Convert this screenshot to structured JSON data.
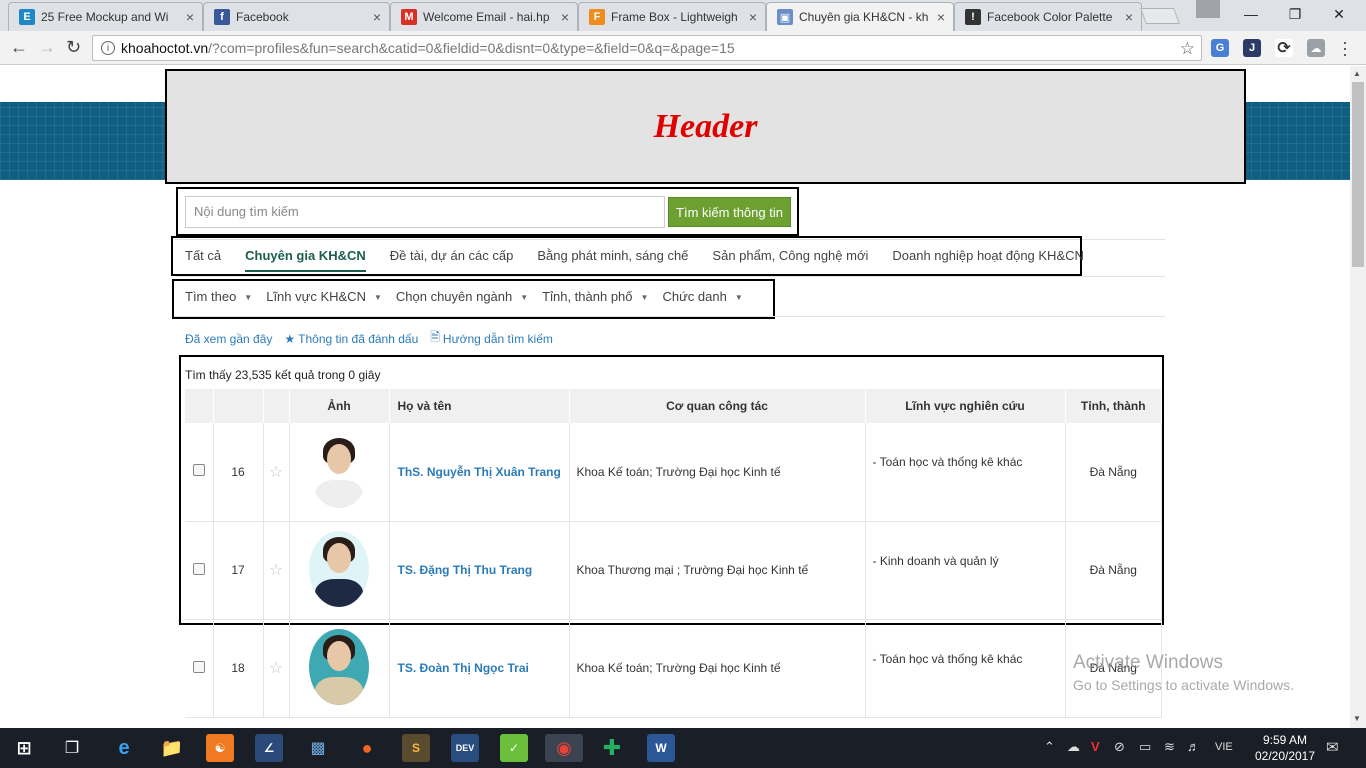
{
  "browser": {
    "tabs": [
      {
        "title": "25 Free Mockup and Wi",
        "favicon": "E",
        "color": "#1e88c7",
        "active": false
      },
      {
        "title": "Facebook",
        "favicon": "f",
        "color": "#3b5998",
        "active": false
      },
      {
        "title": "Welcome Email - hai.hp",
        "favicon": "M",
        "color": "#d93025",
        "active": false
      },
      {
        "title": "Frame Box - Lightweigh",
        "favicon": "F",
        "color": "#f08c1c",
        "active": false
      },
      {
        "title": "Chuyên gia KH&CN - kh",
        "favicon": "▣",
        "color": "#6a8fc7",
        "active": true
      },
      {
        "title": "Facebook Color Palette",
        "favicon": "!",
        "color": "#333333",
        "active": false
      }
    ],
    "address": {
      "host": "khoahoctot.vn",
      "path": "/?com=profiles&fun=search&catid=0&fieldid=0&disnt=0&type=&field=0&q=&page=15"
    }
  },
  "page": {
    "header_text": "Header",
    "search": {
      "placeholder": "Nội dung tìm kiếm",
      "button_label": "Tìm kiếm thông tin"
    },
    "category_tabs": [
      {
        "label": "Tất cả",
        "active": false
      },
      {
        "label": "Chuyên gia KH&CN",
        "active": true
      },
      {
        "label": "Đề tài, dự án các cấp",
        "active": false
      },
      {
        "label": "Bằng phát minh, sáng chế",
        "active": false
      },
      {
        "label": "Sản phẩm, Công nghệ mới",
        "active": false
      },
      {
        "label": "Doanh nghiệp hoạt động KH&CN",
        "active": false
      }
    ],
    "filters": [
      {
        "label": "Tìm theo"
      },
      {
        "label": "Lĩnh vực KH&CN"
      },
      {
        "label": "Chọn chuyên ngành"
      },
      {
        "label": "Tỉnh, thành phố"
      },
      {
        "label": "Chức danh"
      }
    ],
    "quick_links": {
      "recent": "Đã xem gần đây",
      "bookmarked": "Thông tin đã đánh dấu",
      "guide": "Hướng dẫn tìm kiếm"
    },
    "results_count": "Tìm thấy 23,535 kết quả trong 0 giây",
    "table": {
      "headers": {
        "photo": "Ảnh",
        "name": "Họ và tên",
        "org": "Cơ quan công tác",
        "field": "Lĩnh vực nghiên cứu",
        "province": "Tỉnh, thành"
      },
      "rows": [
        {
          "no": "16",
          "name": "ThS. Nguyễn Thị Xuân Trang",
          "org": "Khoa Kế toán; Trường Đại học Kinh tế",
          "field": "- Toán học và thống kê khác",
          "province": "Đà Nẵng",
          "bg": "#ffffff",
          "shirt": "#eeeeee"
        },
        {
          "no": "17",
          "name": "TS. Đặng Thị Thu Trang",
          "org": "Khoa Thương mại ; Trường Đại học Kinh tế",
          "field": "- Kinh doanh và quản lý",
          "province": "Đà Nẵng",
          "bg": "#dff4f7",
          "shirt": "#1e2a44"
        },
        {
          "no": "18",
          "name": "TS. Đoàn Thị Ngọc Trai",
          "org": "Khoa Kế toán; Trường Đại học Kinh tế",
          "field": "- Toán học và thống kê khác",
          "province": "Đà Nẵng",
          "bg": "#3fa9b3",
          "shirt": "#d8c9a8"
        }
      ]
    },
    "watermark": {
      "title": "Activate Windows",
      "subtitle": "Go to Settings to activate Windows."
    }
  },
  "taskbar": {
    "language": "VIE",
    "time": "9:59 AM",
    "date": "02/20/2017"
  }
}
